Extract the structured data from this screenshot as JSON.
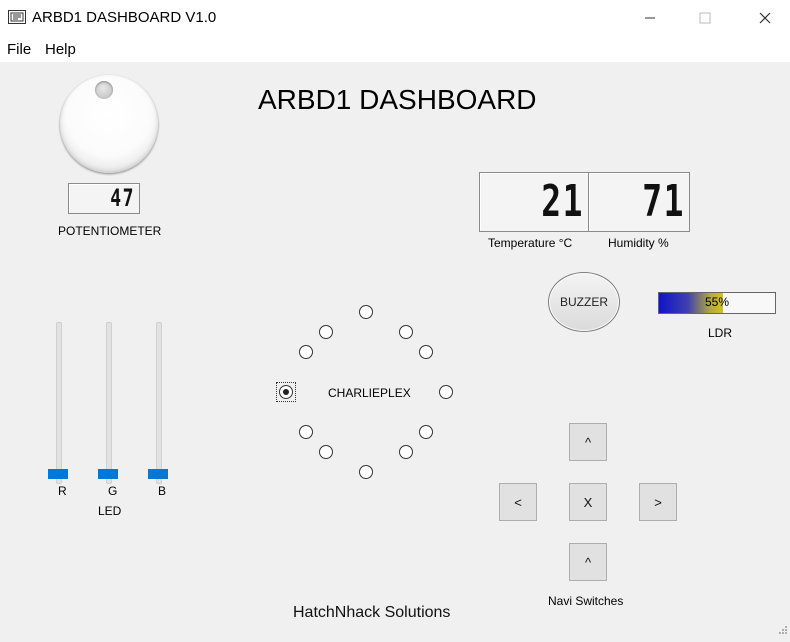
{
  "window": {
    "title": "ARBD1 DASHBOARD V1.0",
    "controls": {
      "minimize": "—",
      "maximize": "☐",
      "close": "✕"
    }
  },
  "menu": {
    "items": [
      "File",
      "Help"
    ]
  },
  "dashboard": {
    "title": "ARBD1 DASHBOARD"
  },
  "potentiometer": {
    "value": "47",
    "label": "POTENTIOMETER"
  },
  "temperature": {
    "value": "21",
    "label": "Temperature °C"
  },
  "humidity": {
    "value": "71",
    "label": "Humidity %"
  },
  "buzzer": {
    "label": "BUZZER"
  },
  "ldr": {
    "percent": 55,
    "text": "55%",
    "label": "LDR"
  },
  "led": {
    "label": "LED",
    "sliders": [
      {
        "name": "R",
        "value": 0
      },
      {
        "name": "G",
        "value": 0
      },
      {
        "name": "B",
        "value": 0
      }
    ]
  },
  "charlieplex": {
    "label": "CHARLIEPLEX",
    "selected_index": 6,
    "count": 12
  },
  "navi": {
    "label": "Navi Switches",
    "up": "^",
    "left": "<",
    "center": "X",
    "right": ">",
    "down": "^"
  },
  "footer": {
    "text": "HatchNhack Solutions"
  },
  "colors": {
    "accent": "#0078d7",
    "background": "#f0f0f0"
  }
}
